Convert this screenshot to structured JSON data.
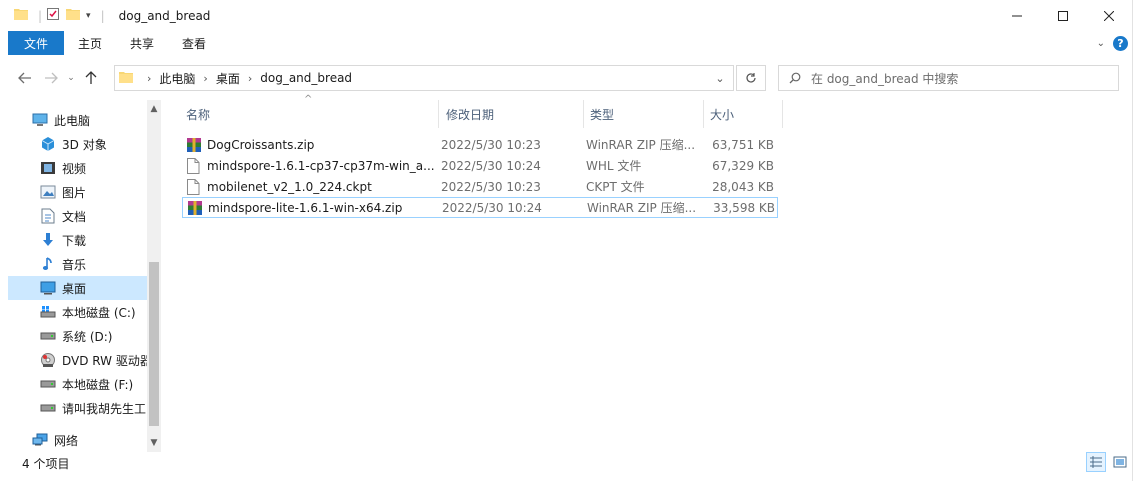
{
  "window": {
    "title": "dog_and_bread",
    "quick_access_icons": [
      "folder-icon",
      "properties-checklist-icon",
      "new-folder-icon",
      "customize-dropdown-icon"
    ]
  },
  "ribbon": {
    "tabs": [
      {
        "label": "文件",
        "active": true
      },
      {
        "label": "主页"
      },
      {
        "label": "共享"
      },
      {
        "label": "查看"
      }
    ]
  },
  "address": {
    "crumbs": [
      "此电脑",
      "桌面",
      "dog_and_bread"
    ],
    "search_placeholder": "在 dog_and_bread 中搜索"
  },
  "sidebar": {
    "items": [
      {
        "label": "此电脑",
        "icon": "pc-icon",
        "indent": 0
      },
      {
        "label": "3D 对象",
        "icon": "3d-objects-icon",
        "indent": 1
      },
      {
        "label": "视频",
        "icon": "video-icon",
        "indent": 1
      },
      {
        "label": "图片",
        "icon": "pictures-icon",
        "indent": 1
      },
      {
        "label": "文档",
        "icon": "document-icon",
        "indent": 1
      },
      {
        "label": "下载",
        "icon": "download-icon",
        "indent": 1
      },
      {
        "label": "音乐",
        "icon": "music-icon",
        "indent": 1
      },
      {
        "label": "桌面",
        "icon": "desktop-icon",
        "indent": 1,
        "selected": true
      },
      {
        "label": "本地磁盘 (C:)",
        "icon": "windows-drive-icon",
        "indent": 1
      },
      {
        "label": "系统 (D:)",
        "icon": "drive-icon",
        "indent": 1
      },
      {
        "label": "DVD RW 驱动器",
        "icon": "dvd-drive-icon",
        "indent": 1
      },
      {
        "label": "本地磁盘 (F:)",
        "icon": "drive-icon",
        "indent": 1
      },
      {
        "label": "请叫我胡先生工",
        "icon": "drive-icon",
        "indent": 1
      },
      {
        "label": "网络",
        "icon": "network-icon",
        "indent": 0
      }
    ]
  },
  "columns": {
    "name": "名称",
    "date": "修改日期",
    "type": "类型",
    "size": "大小"
  },
  "files": [
    {
      "name": "DogCroissants.zip",
      "date": "2022/5/30 10:23",
      "type": "WinRAR ZIP 压缩...",
      "size": "63,751 KB",
      "icon": "winrar-archive-icon"
    },
    {
      "name": "mindspore-1.6.1-cp37-cp37m-win_a...",
      "date": "2022/5/30 10:24",
      "type": "WHL 文件",
      "size": "67,329 KB",
      "icon": "file-icon"
    },
    {
      "name": "mobilenet_v2_1.0_224.ckpt",
      "date": "2022/5/30 10:23",
      "type": "CKPT 文件",
      "size": "28,043 KB",
      "icon": "file-icon"
    },
    {
      "name": "mindspore-lite-1.6.1-win-x64.zip",
      "date": "2022/5/30 10:24",
      "type": "WinRAR ZIP 压缩...",
      "size": "33,598 KB",
      "icon": "winrar-archive-icon",
      "selected": true
    }
  ],
  "status": {
    "item_count": "4 个项目"
  },
  "colors": {
    "accent": "#1979ca",
    "selection": "#cce8ff",
    "selection_border": "#99d1ff",
    "header_text": "#4c607a"
  }
}
